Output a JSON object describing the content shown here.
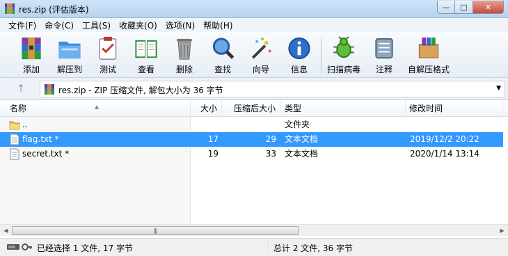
{
  "window": {
    "title": "res.zip (评估版本)",
    "minimize_glyph": "—",
    "maximize_glyph": "□",
    "close_glyph": "✕"
  },
  "menu": [
    "文件(F)",
    "命令(C)",
    "工具(S)",
    "收藏夹(O)",
    "选项(N)",
    "帮助(H)"
  ],
  "toolbar": {
    "buttons": [
      {
        "label": "添加",
        "icon": "add-archive-icon"
      },
      {
        "label": "解压到",
        "icon": "extract-to-icon"
      },
      {
        "label": "测试",
        "icon": "test-icon"
      },
      {
        "label": "查看",
        "icon": "view-icon"
      },
      {
        "label": "删除",
        "icon": "delete-icon"
      },
      {
        "label": "查找",
        "icon": "find-icon"
      },
      {
        "label": "向导",
        "icon": "wizard-icon"
      },
      {
        "label": "信息",
        "icon": "info-icon"
      },
      {
        "label": "扫描病毒",
        "icon": "virus-scan-icon"
      },
      {
        "label": "注释",
        "icon": "comment-icon"
      },
      {
        "label": "自解压格式",
        "icon": "sfx-icon"
      }
    ]
  },
  "address": {
    "up_glyph": "🡑",
    "path_text": "res.zip - ZIP 压缩文件, 解包大小为 36 字节",
    "dropdown_glyph": "▼"
  },
  "columns": {
    "name": "名称",
    "size": "大小",
    "packed": "压缩后大小",
    "type": "类型",
    "modified": "修改时间",
    "sort_glyph": "▲"
  },
  "files": [
    {
      "name": "..",
      "size": "",
      "packed": "",
      "type": "文件夹",
      "modified": "",
      "kind": "folder",
      "selected": false
    },
    {
      "name": "flag.txt *",
      "size": "17",
      "packed": "29",
      "type": "文本文档",
      "modified": "2019/12/2 20:22",
      "kind": "text",
      "selected": true
    },
    {
      "name": "secret.txt *",
      "size": "19",
      "packed": "33",
      "type": "文本文档",
      "modified": "2020/1/14 13:14",
      "kind": "text",
      "selected": false
    }
  ],
  "scrollbar": {
    "left_glyph": "◀",
    "right_glyph": "▶",
    "grip": "|||"
  },
  "status": {
    "left": "已经选择 1 文件, 17 字节",
    "right": "总计 2 文件, 36 字节"
  },
  "colors": {
    "selection": "#3399ff",
    "titlebar": "#cfe3f7"
  }
}
